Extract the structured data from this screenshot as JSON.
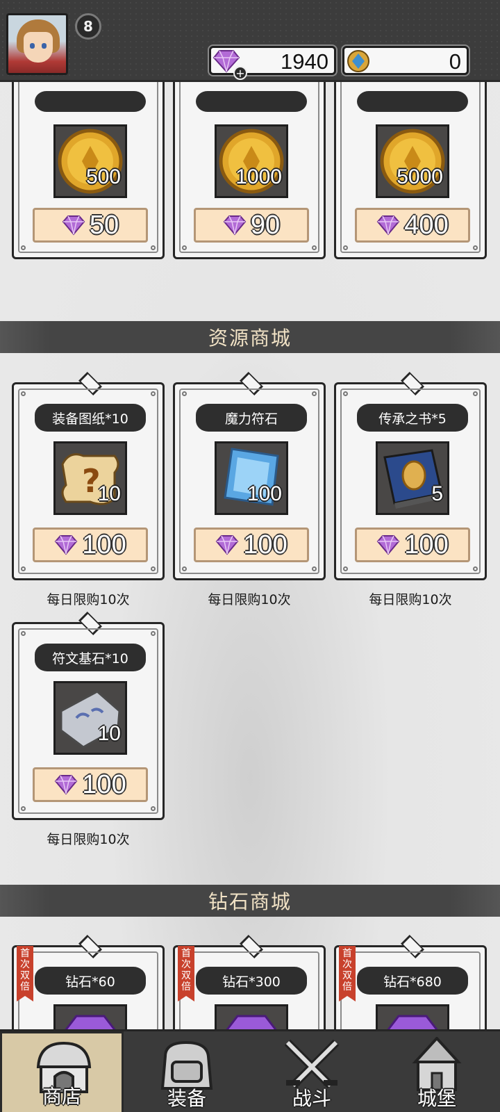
{
  "header": {
    "level": "8",
    "gems": "1940",
    "gem_plus": "+",
    "coins": "0"
  },
  "gold_shop": {
    "items": [
      {
        "qty": "500",
        "price": "50"
      },
      {
        "qty": "1000",
        "price": "90"
      },
      {
        "qty": "5000",
        "price": "400"
      }
    ]
  },
  "resource_shop": {
    "title": "资源商城",
    "items": [
      {
        "name": "装备图纸*10",
        "qty": "10",
        "price": "100",
        "limit": "每日限购10次",
        "icon": "scroll-icon"
      },
      {
        "name": "魔力符石",
        "qty": "100",
        "price": "100",
        "limit": "每日限购10次",
        "icon": "crystal-icon"
      },
      {
        "name": "传承之书*5",
        "qty": "5",
        "price": "100",
        "limit": "每日限购10次",
        "icon": "book-icon"
      },
      {
        "name": "符文基石*10",
        "qty": "10",
        "price": "100",
        "limit": "每日限购10次",
        "icon": "rune-stone-icon"
      }
    ]
  },
  "diamond_shop": {
    "title": "钻石商城",
    "badge": "首次双倍",
    "items": [
      {
        "name": "钻石*60"
      },
      {
        "name": "钻石*300"
      },
      {
        "name": "钻石*680"
      }
    ]
  },
  "tabs": [
    {
      "label": "商店",
      "icon": "shop-icon",
      "active": true
    },
    {
      "label": "装备",
      "icon": "backpack-icon",
      "active": false
    },
    {
      "label": "战斗",
      "icon": "crossed-swords-icon",
      "active": false
    },
    {
      "label": "城堡",
      "icon": "castle-icon",
      "active": false
    }
  ],
  "colors": {
    "band": "#454545",
    "price_bg": "#fbe3c3",
    "ribbon": "#c8412c",
    "gem": "#b26bd6",
    "gold": "#e0a62a"
  }
}
